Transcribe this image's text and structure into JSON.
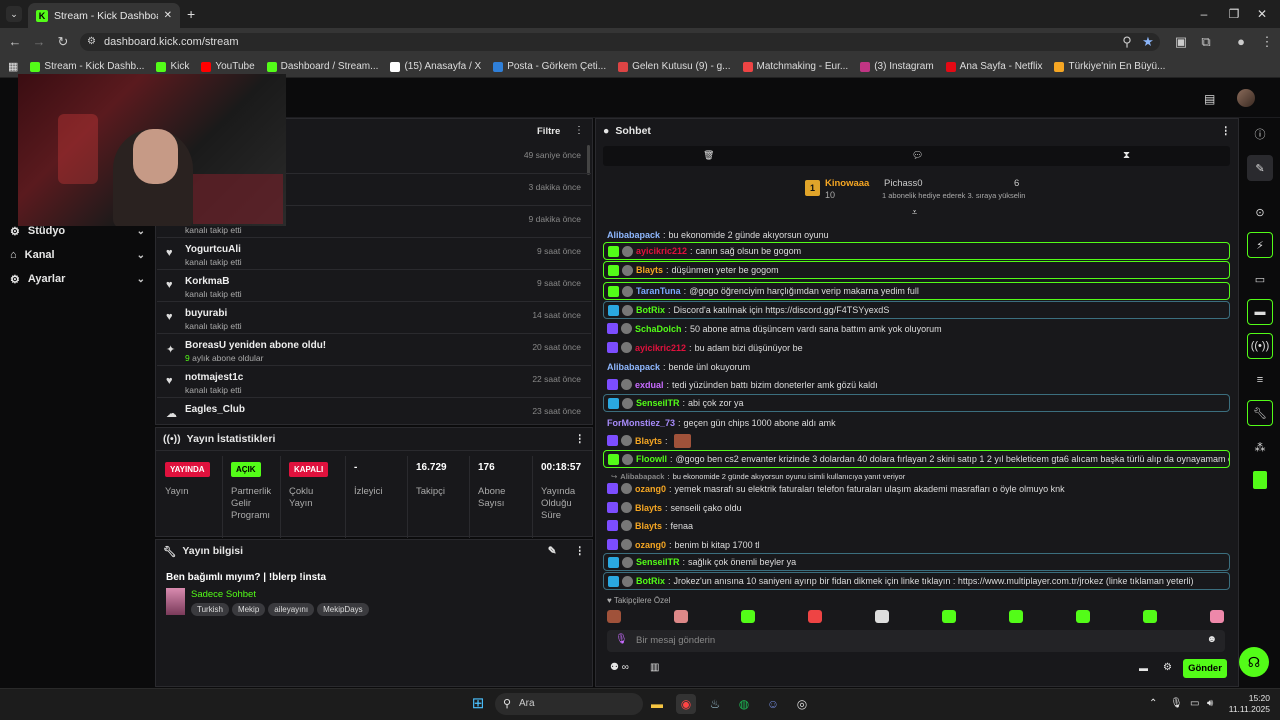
{
  "browser": {
    "tab_title": "Stream - Kick Dashboard",
    "url": "dashboard.kick.com/stream",
    "bookmarks": [
      {
        "label": "Stream - Kick Dashb...",
        "color": "#53fc18"
      },
      {
        "label": "Kick",
        "color": "#53fc18"
      },
      {
        "label": "YouTube",
        "color": "#ff0000"
      },
      {
        "label": "Dashboard / Stream...",
        "color": "#53fc18"
      },
      {
        "label": "(15) Anasayfa / X",
        "color": "#ffffff"
      },
      {
        "label": "Posta - Görkem Çeti...",
        "color": "#2f7fd8"
      },
      {
        "label": "Gelen Kutusu (9) - g...",
        "color": "#d44"
      },
      {
        "label": "Matchmaking - Eur...",
        "color": "#e44"
      },
      {
        "label": "(3) Instagram",
        "color": "#c13584"
      },
      {
        "label": "Ana Sayfa - Netflix",
        "color": "#e50914"
      },
      {
        "label": "Türkiye'nin En Büyü...",
        "color": "#f5a623"
      }
    ]
  },
  "sidebar": {
    "items": [
      {
        "label": "Stüdyo",
        "icon": "studio-icon"
      },
      {
        "label": "Kanal",
        "icon": "channel-icon"
      },
      {
        "label": "Ayarlar",
        "icon": "settings-icon"
      }
    ]
  },
  "activity": {
    "filter_label": "Filtre",
    "rows": [
      {
        "name": "",
        "sub": "",
        "time": "49 saniye önce"
      },
      {
        "name": "",
        "sub": "",
        "time": "3 dakika önce"
      },
      {
        "name": "",
        "sub": "kanalı takip etti",
        "time": "9 dakika önce"
      },
      {
        "name": "YogurtcuAli",
        "sub": "kanalı takip etti",
        "time": "9 saat önce"
      },
      {
        "name": "KorkmaB",
        "sub": "kanalı takip etti",
        "time": "9 saat önce"
      },
      {
        "name": "buyurabi",
        "sub": "kanalı takip etti",
        "time": "14 saat önce"
      },
      {
        "name": "BoreasU yeniden abone oldu!",
        "sub_num": "9",
        "sub": "aylık abone oldular",
        "time": "20 saat önce"
      },
      {
        "name": "notmajest1c",
        "sub": "kanalı takip etti",
        "time": "22 saat önce"
      },
      {
        "name": "Eagles_Club",
        "sub": "",
        "time": "23 saat önce"
      }
    ]
  },
  "stats": {
    "title": "Yayın İstatistikleri",
    "items": [
      {
        "value": "YAYINDA",
        "label": "Yayın",
        "badge_color": "#e0113d"
      },
      {
        "value": "AÇIK",
        "label": "Partnerlik Gelir Programı",
        "badge_color": "#53fc18"
      },
      {
        "value": "KAPALI",
        "label": "Çoklu Yayın",
        "badge_color": "#e0113d"
      },
      {
        "value": "-",
        "label": "İzleyici"
      },
      {
        "value": "16.729",
        "label": "Takipçi"
      },
      {
        "value": "176",
        "label": "Abone Sayısı"
      },
      {
        "value": "00:18:57",
        "label": "Yayında Olduğu Süre"
      }
    ]
  },
  "stream_info": {
    "title": "Yayın bilgisi",
    "stream_title": "Ben bağımlı mıyım? | !blerp !insta",
    "category": "Sadece Sohbet",
    "tags": [
      "Turkish",
      "Mekip",
      "aileyayını",
      "MekipDays"
    ]
  },
  "chat": {
    "title": "Sohbet",
    "gift_leader": {
      "name": "Kinowaaa",
      "count": "10",
      "name2": "Pichass0",
      "count2": "6",
      "note": "1 abonelik hediye ederek 3. sıraya yükselin"
    },
    "messages": [
      {
        "user": "Alibabapack",
        "color": "#8fb8ff",
        "text": "bu ekonomide 2 günde akıyorsun oyunu",
        "style": ""
      },
      {
        "user": "ayicikric212",
        "color": "#e0113d",
        "text": "canın sağ olsun be gogom",
        "style": "hl"
      },
      {
        "user": "Blayts",
        "color": "#f5a623",
        "text": "düşünmen yeter be gogom",
        "style": "hl"
      },
      {
        "user": "TaranTuna",
        "color": "#7aa7ff",
        "text": "@gogo öğrenciyim harçlığımdan verip makarna yedim full",
        "style": "hl"
      },
      {
        "user": "BotRix",
        "color": "#53fc18",
        "text": "Discord'a katılmak için https://discord.gg/F4TSYyexdS",
        "style": "hl2"
      },
      {
        "user": "SchaDolch",
        "color": "#53fc18",
        "text": "50 abone atma düşüncem vardı sana battım amk yok oluyorum",
        "style": ""
      },
      {
        "user": "ayicikric212",
        "color": "#e0113d",
        "text": "bu adam bizi düşünüyor be",
        "style": ""
      },
      {
        "user": "Alibabapack",
        "color": "#8fb8ff",
        "text": "bende ünl okuyorum",
        "style": ""
      },
      {
        "user": "exdual",
        "color": "#c86bff",
        "text": "tedi yüzünden battı bizim doneterler amk gözü kaldı",
        "style": ""
      },
      {
        "user": "SenseiITR",
        "color": "#53fc18",
        "text": "abi çok zor ya",
        "style": "hl2"
      },
      {
        "user": "ForMonstiez_73",
        "color": "#a78bfa",
        "text": "geçen gün chips 1000 abone aldı amk",
        "style": ""
      },
      {
        "user": "Blayts",
        "color": "#f5a623",
        "text": "",
        "style": ""
      },
      {
        "user": "Floowll",
        "color": "#53fc18",
        "text": "@gogo ben cs2 envanter krizinde 3 dolardan 40 dolara fırlayan 2 skini satıp 1 2 yıl bekleticem gta6 alıcam başka türlü alıp da oynayamam çünkü",
        "style": "hl"
      },
      {
        "user": "Alibabapack",
        "color": "#888888",
        "text": "bu ekonomide 2 günde akıyorsun oyunu isimli kullanıcıya yanıt veriyor",
        "style": "reply"
      },
      {
        "user": "ozang0",
        "color": "#f5a623",
        "text": "yemek masrafı su elektrik faturaları telefon faturaları ulaşım akademi masrafları o öyle olmuyo knk",
        "style": ""
      },
      {
        "user": "Blayts",
        "color": "#f5a623",
        "text": "senseili çako oldu",
        "style": ""
      },
      {
        "user": "Blayts",
        "color": "#f5a623",
        "text": "fenaa",
        "style": ""
      },
      {
        "user": "ozang0",
        "color": "#f5a623",
        "text": "benim bi kitap 1700 tl",
        "style": ""
      },
      {
        "user": "SenseiITR",
        "color": "#53fc18",
        "text": "sağlık çok önemli beyler ya",
        "style": "hl2"
      },
      {
        "user": "BotRix",
        "color": "#53fc18",
        "text": "Jrokez'un anısına 10 saniyeni ayırıp bir fidan dikmek için linke tıklayın : https://www.multiplayer.com.tr/jrokez (linke tıklaman yeterli)",
        "style": "hl2"
      }
    ],
    "emote_label": "Takipçilere Özel",
    "input_placeholder": "Bir mesaj gönderin",
    "send_label": "Gönder"
  },
  "taskbar": {
    "search_label": "Ara",
    "time": "15:20",
    "date": "11.11.2025"
  }
}
